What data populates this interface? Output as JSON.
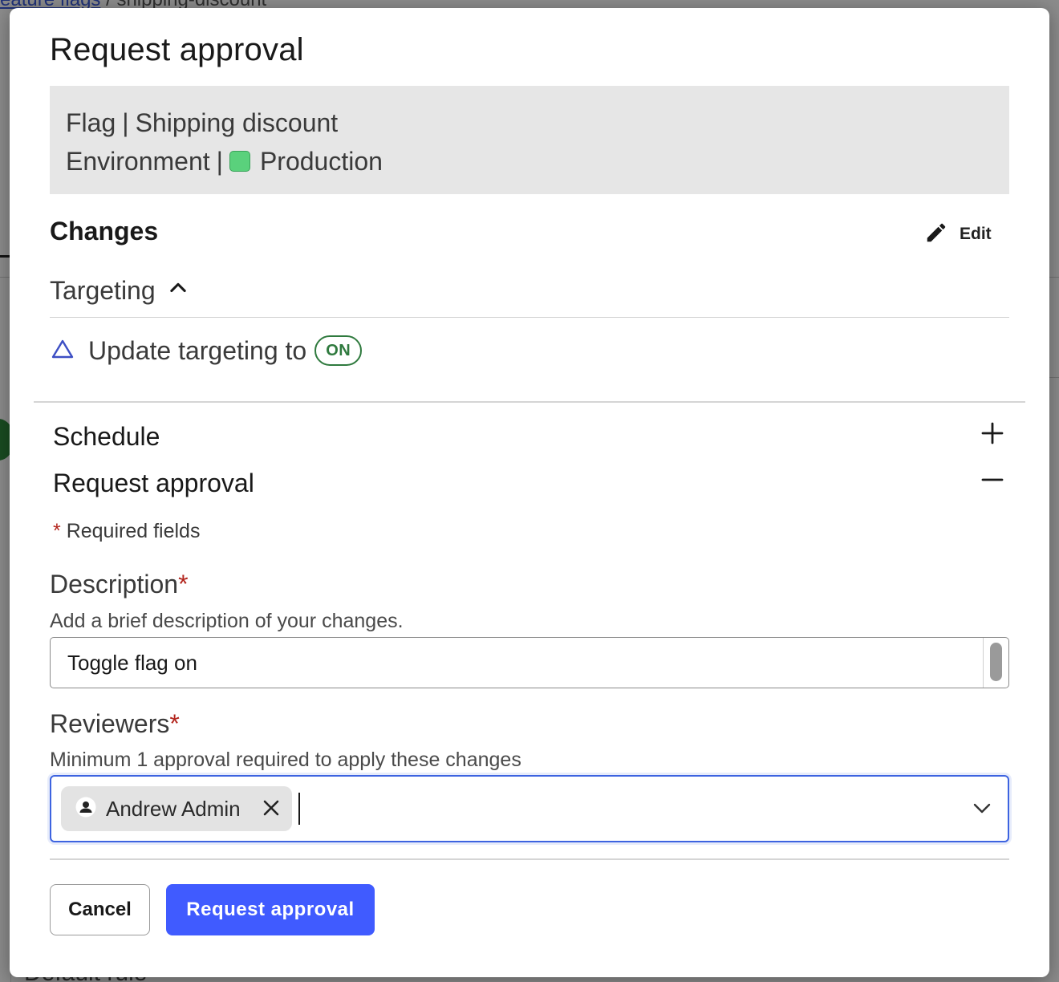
{
  "background": {
    "breadcrumb_link": "eature flags",
    "breadcrumb_separator": "/",
    "breadcrumb_current": "shipping-discount",
    "bottom_text": "Default rule"
  },
  "modal": {
    "title": "Request approval",
    "summary": {
      "flag_label": "Flag",
      "flag_value": "Shipping discount",
      "env_label": "Environment",
      "env_value": "Production",
      "env_color": "#5ad17c",
      "separator": "|"
    },
    "changes": {
      "heading": "Changes",
      "edit_label": "Edit",
      "targeting_label": "Targeting",
      "update_text": "Update targeting to",
      "status_pill": "ON"
    },
    "sections": {
      "schedule_label": "Schedule",
      "request_label": "Request approval"
    },
    "form": {
      "required_star": "*",
      "required_note": "Required fields",
      "description_label": "Description",
      "description_hint": "Add a brief description of your changes.",
      "description_value": "Toggle flag on",
      "reviewers_label": "Reviewers",
      "reviewers_hint": "Minimum 1 approval required to apply these changes",
      "reviewer_chip": "Andrew Admin"
    },
    "buttons": {
      "cancel": "Cancel",
      "submit": "Request approval"
    }
  },
  "colors": {
    "primary": "#405bff",
    "on_pill": "#2f7a3e",
    "required": "#b3261e",
    "focus_border": "#3d63e0"
  },
  "icons": [
    "pencil-icon",
    "chevron-up-icon",
    "triangle-delta-icon",
    "plus-icon",
    "minus-icon",
    "person-icon",
    "close-icon",
    "chevron-down-icon"
  ]
}
